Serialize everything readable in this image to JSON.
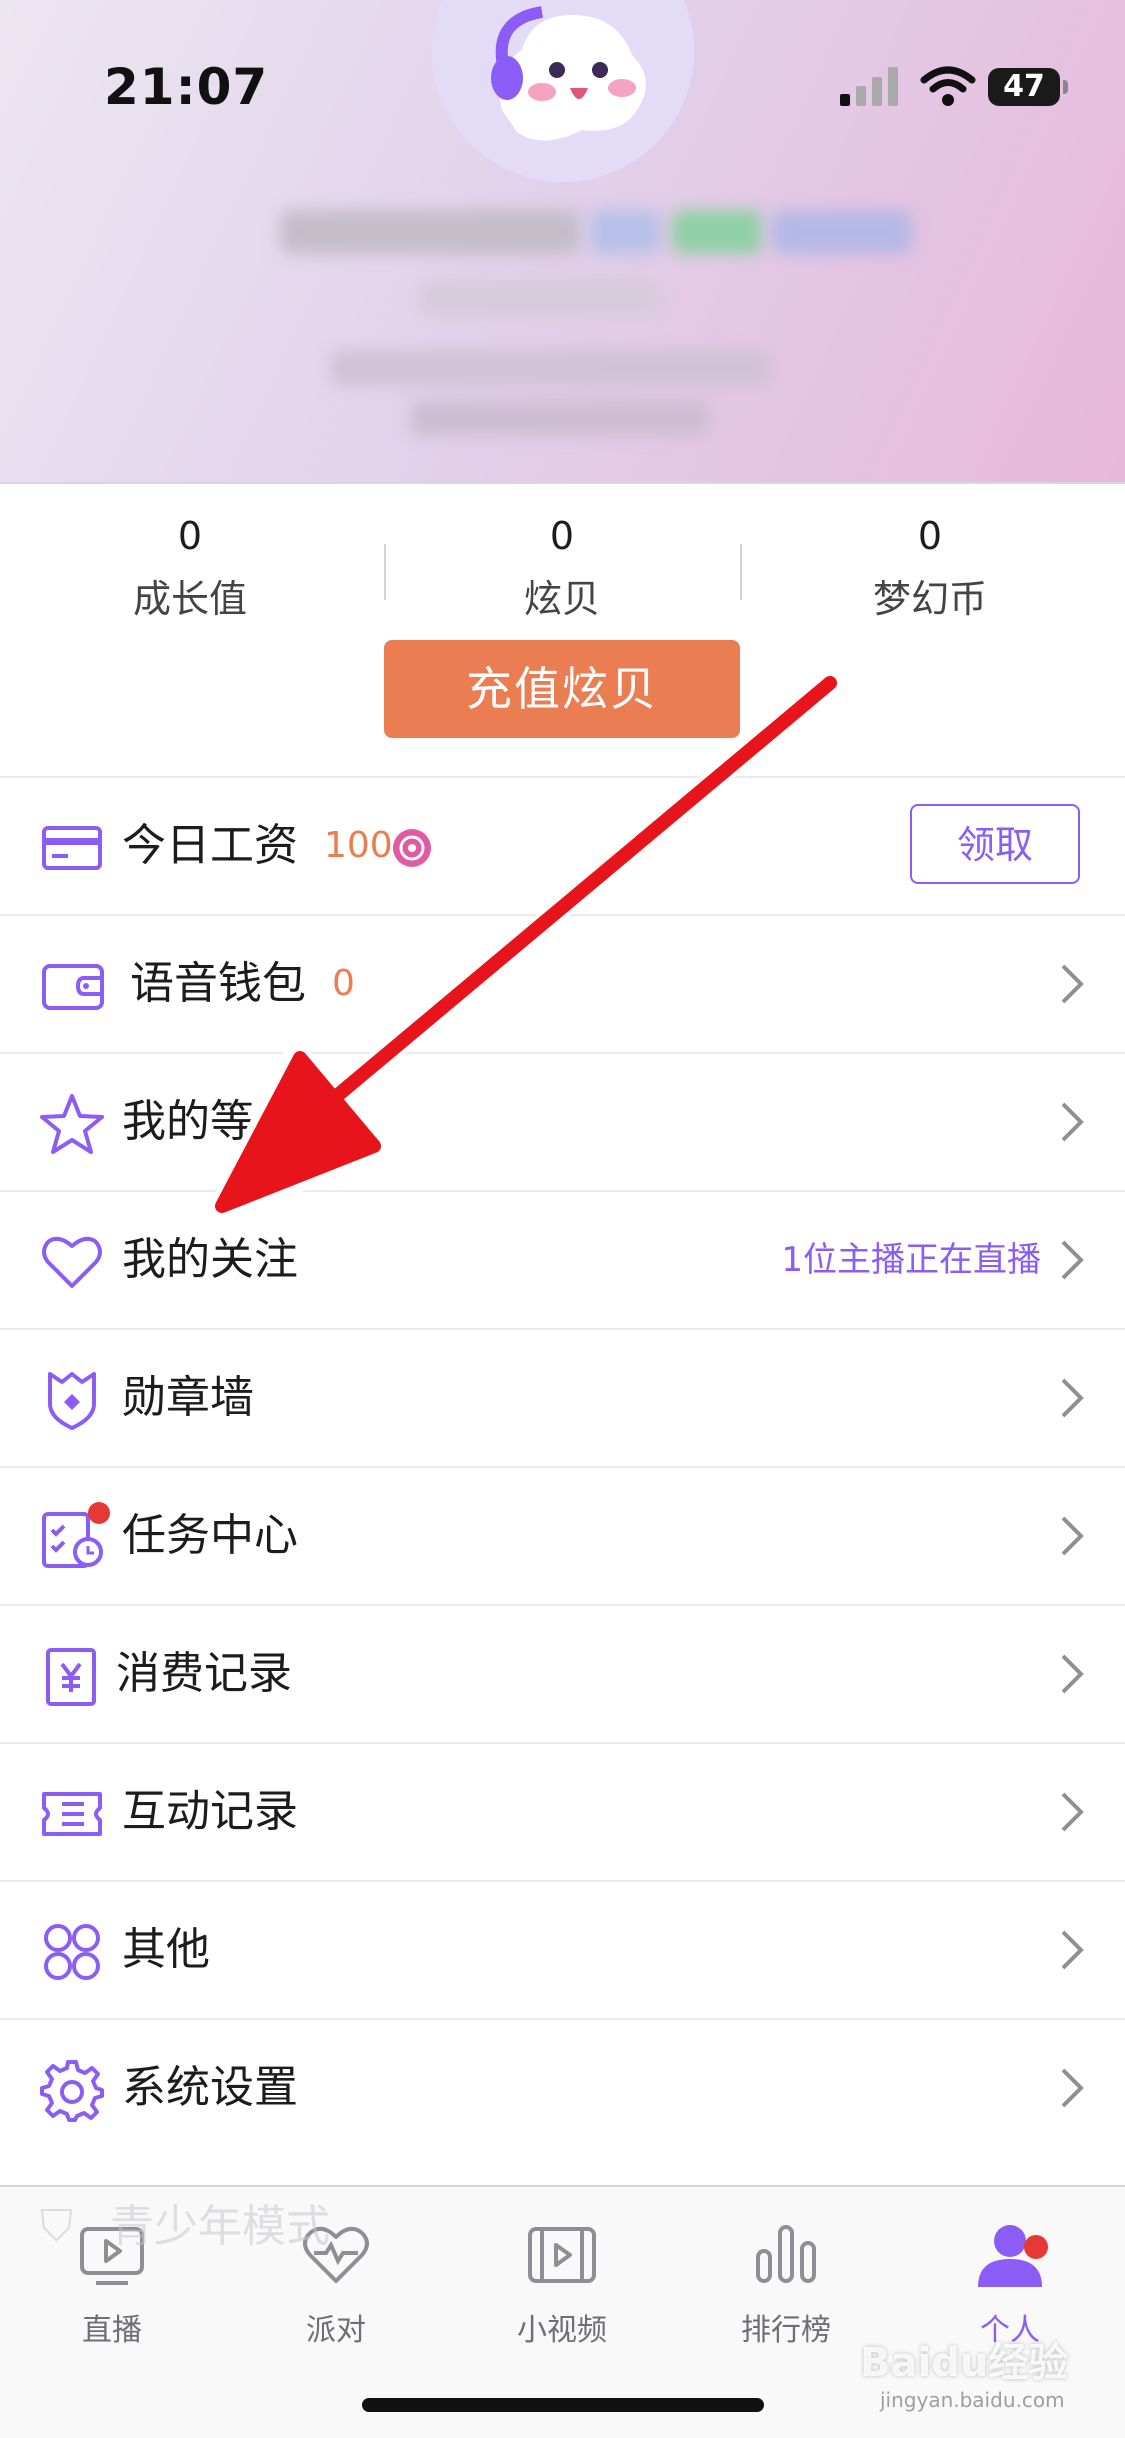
{
  "status_bar": {
    "time": "21:07",
    "battery": "47"
  },
  "stats": [
    {
      "value": "0",
      "label": "成长值"
    },
    {
      "value": "0",
      "label": "炫贝"
    },
    {
      "value": "0",
      "label": "梦幻币"
    }
  ],
  "recharge_label": "充值炫贝",
  "menu": {
    "wage": {
      "label": "今日工资",
      "value": "100",
      "button": "领取"
    },
    "wallet": {
      "label": "语音钱包",
      "value": "0"
    },
    "level": {
      "label": "我的等级"
    },
    "follow": {
      "label": "我的关注",
      "status": "1位主播正在直播"
    },
    "medals": {
      "label": "勋章墙"
    },
    "tasks": {
      "label": "任务中心"
    },
    "spending": {
      "label": "消费记录"
    },
    "interaction": {
      "label": "互动记录"
    },
    "other": {
      "label": "其他"
    },
    "settings": {
      "label": "系统设置"
    },
    "teen_mode": {
      "label": "青少年模式"
    }
  },
  "tabbar": [
    {
      "label": "直播",
      "icon": "tv-icon"
    },
    {
      "label": "派对",
      "icon": "heart-pulse-icon"
    },
    {
      "label": "小视频",
      "icon": "film-icon"
    },
    {
      "label": "排行榜",
      "icon": "bars-icon"
    },
    {
      "label": "个人",
      "icon": "person-icon"
    }
  ],
  "watermark": {
    "brand": "Baidu经验",
    "sub": "jingyan.baidu.com"
  },
  "colors": {
    "accent": "#8b5cf6",
    "orange": "#eb7d52",
    "alert": "#e53935",
    "arrow": "#e8141c"
  }
}
